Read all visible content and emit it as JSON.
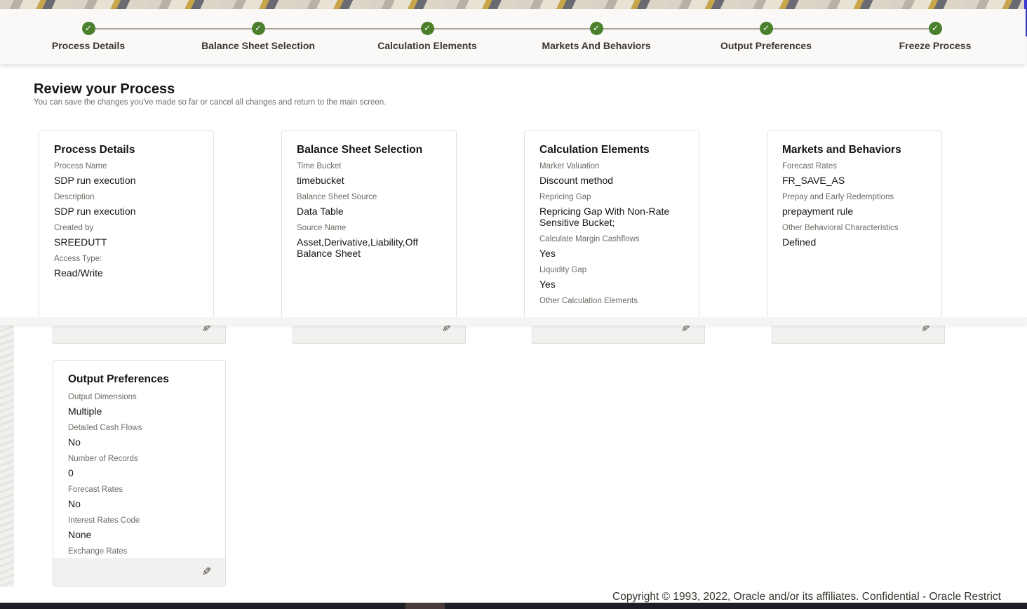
{
  "train": {
    "steps": [
      {
        "label": "Process Details"
      },
      {
        "label": "Balance Sheet Selection"
      },
      {
        "label": "Calculation Elements"
      },
      {
        "label": "Markets And Behaviors"
      },
      {
        "label": "Output Preferences"
      },
      {
        "label": "Freeze Process"
      }
    ],
    "check_glyph": "✓",
    "accent_color": "#4a7f2c"
  },
  "header": {
    "title": "Review your Process",
    "subtitle": "You can save the changes you've made so far or cancel all changes and return to the main screen."
  },
  "cards": {
    "process_details": {
      "title": "Process Details",
      "fields": [
        {
          "label": "Process Name",
          "value": "SDP run execution"
        },
        {
          "label": "Description",
          "value": "SDP run execution"
        },
        {
          "label": "Created by",
          "value": "SREEDUTT"
        },
        {
          "label": "Access Type:",
          "value": "Read/Write"
        }
      ]
    },
    "balance_sheet": {
      "title": "Balance Sheet Selection",
      "fields": [
        {
          "label": "Time Bucket",
          "value": "timebucket"
        },
        {
          "label": "Balance Sheet Source",
          "value": "Data Table"
        },
        {
          "label": "Source Name",
          "value": "Asset,Derivative,Liability,Off Balance Sheet"
        }
      ]
    },
    "calculation": {
      "title": "Calculation Elements",
      "fields": [
        {
          "label": "Market Valuation",
          "value": "Discount method"
        },
        {
          "label": "Repricing Gap",
          "value": "Repricing Gap With Non-Rate Sensitive Bucket;"
        },
        {
          "label": "Calculate Margin Cashflows",
          "value": "Yes"
        },
        {
          "label": "Liquidity Gap",
          "value": "Yes"
        },
        {
          "label": "Other Calculation Elements",
          "value": ""
        }
      ]
    },
    "markets": {
      "title": "Markets and Behaviors",
      "fields": [
        {
          "label": "Forecast Rates",
          "value": "FR_SAVE_AS"
        },
        {
          "label": "Prepay and Early Redemptions",
          "value": "prepayment rule"
        },
        {
          "label": "Other Behavioral Characteristics",
          "value": "Defined"
        }
      ]
    },
    "output": {
      "title": "Output Preferences",
      "fields": [
        {
          "label": "Output Dimensions",
          "value": "Multiple"
        },
        {
          "label": "Detailed Cash Flows",
          "value": "No"
        },
        {
          "label": "Number of Records",
          "value": "0"
        },
        {
          "label": "Forecast Rates",
          "value": "No"
        },
        {
          "label": "Interest Rates Code",
          "value": "None"
        },
        {
          "label": "Exchange Rates",
          "value": ""
        }
      ]
    }
  },
  "edit_icon": "edit-pencil",
  "footer": {
    "copyright": "Copyright © 1993, 2022, Oracle and/or its affiliates.  Confidential - Oracle Restrict"
  }
}
